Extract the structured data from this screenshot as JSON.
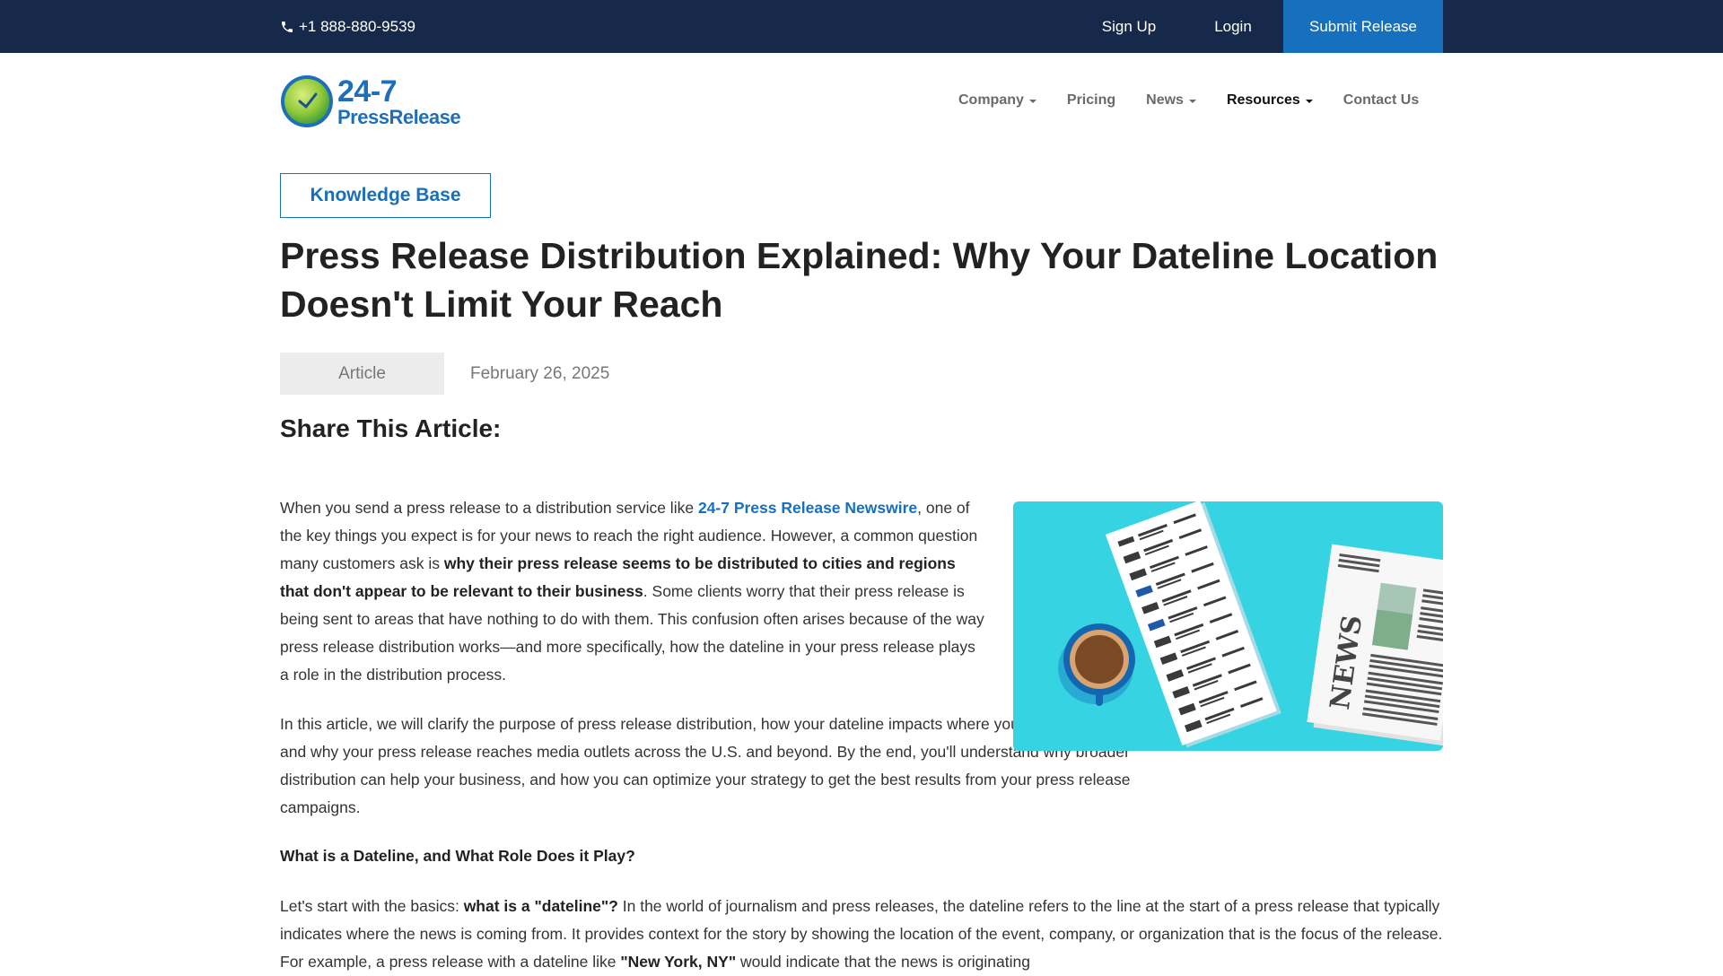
{
  "topbar": {
    "phone": "+1 888-880-9539",
    "signup": "Sign Up",
    "login": "Login",
    "submit": "Submit Release"
  },
  "logo": {
    "top": "24-7",
    "bottom": "PressRelease"
  },
  "nav": {
    "company": "Company",
    "pricing": "Pricing",
    "news": "News",
    "resources": "Resources",
    "contact": "Contact Us"
  },
  "article": {
    "category": "Knowledge Base",
    "title": "Press Release Distribution Explained: Why Your Dateline Location Doesn't Limit Your Reach",
    "type": "Article",
    "date": "February 26, 2025",
    "share": "Share This Article:",
    "p1": {
      "a": "When you send a press release to a distribution service like ",
      "link": "24-7 Press Release Newswire",
      "b": ", one of the key things you expect is for your news to reach the right audience. However, a common question many customers ask is ",
      "bold": "why their press release seems to be distributed to cities and regions that don't appear to be relevant to their business",
      "c": ". Some clients worry that their press release is being sent to areas that have nothing to do with them. This confusion often arises because of the way press release distribution works—and more specifically, how the dateline in your press release plays a role in the distribution process."
    },
    "p2": "In this article, we will clarify the purpose of press release distribution, how your dateline impacts where your press release is sent, and why your press release reaches media outlets across the U.S. and beyond. By the end, you'll understand why broader distribution can help your business, and how you can optimize your strategy to get the best results from your press release campaigns.",
    "h3": "What is a Dateline, and What Role Does it Play?",
    "p3": {
      "a": "Let's start with the basics: ",
      "bold1": "what is a \"dateline\"?",
      "b": " In the world of journalism and press releases, the dateline refers to the line at the start of a press release that typically indicates where the news is coming from. It provides context for the story by showing the location of the event, company, or organization that is the focus of the release. For example, a press release with a dateline like ",
      "bold2": "\"New York, NY\"",
      "c": " would indicate that the news is originating"
    },
    "illustration_text": "NEWS"
  }
}
